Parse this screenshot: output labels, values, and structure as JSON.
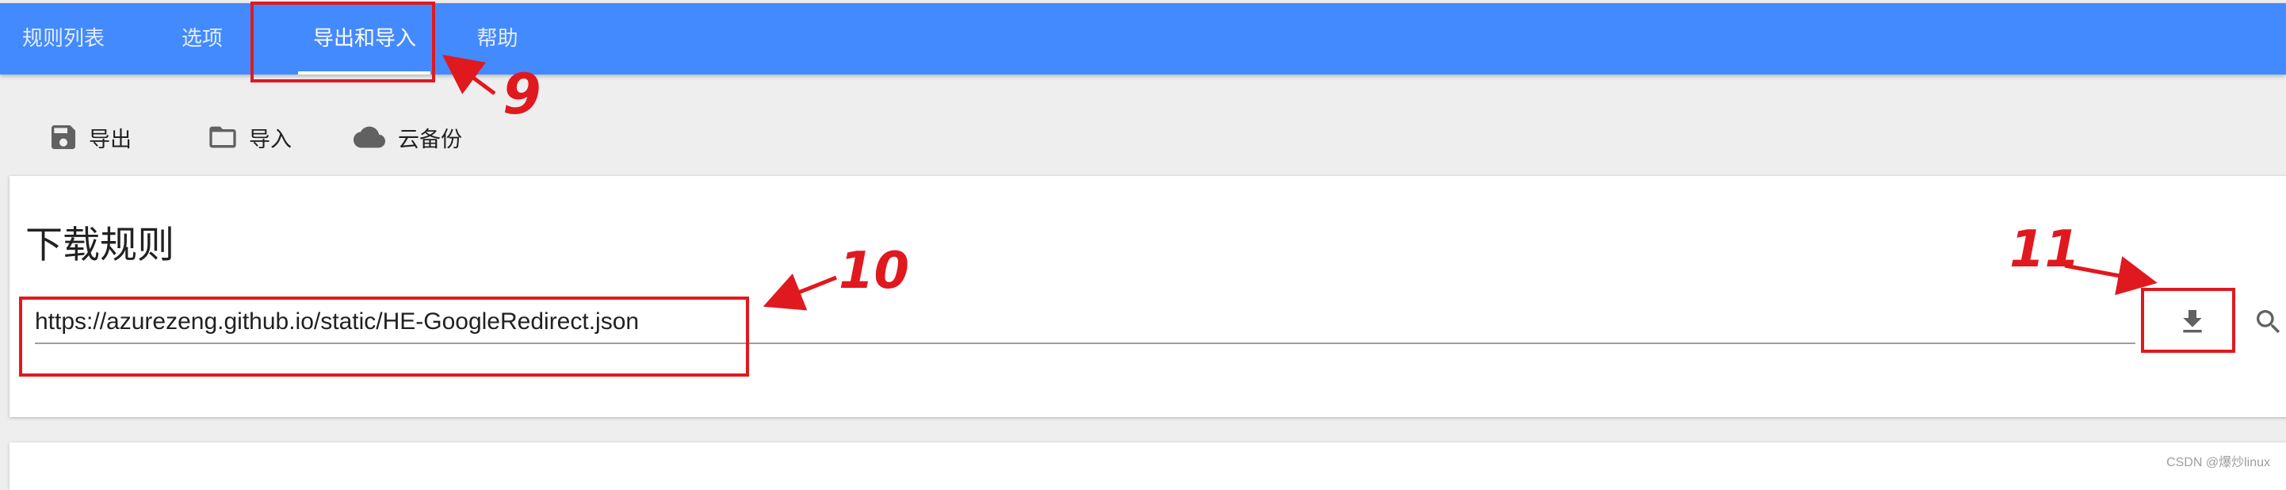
{
  "tabs": [
    {
      "label": "规则列表",
      "active": false
    },
    {
      "label": "选项",
      "active": false
    },
    {
      "label": "导出和导入",
      "active": true
    },
    {
      "label": "帮助",
      "active": false
    }
  ],
  "toolbar": {
    "export_label": "导出",
    "import_label": "导入",
    "cloud_label": "云备份"
  },
  "card": {
    "title": "下载规则",
    "url_value": "https://azurezeng.github.io/static/HE-GoogleRedirect.json"
  },
  "annotations": {
    "tab_number": "9",
    "url_number": "10",
    "download_number": "11",
    "color": "#e0191f"
  },
  "colors": {
    "app_bar": "#448aff",
    "background": "#eeeeee"
  },
  "icons": [
    "save-icon",
    "folder-icon",
    "cloud-icon",
    "download-icon",
    "search-icon"
  ],
  "watermark": "CSDN @爆炒linux"
}
